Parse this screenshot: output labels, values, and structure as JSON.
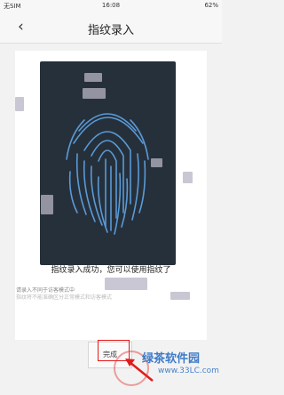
{
  "status": {
    "carrier": "无SIM",
    "time": "16:08",
    "battery": "62%"
  },
  "title": "指纹录入",
  "back_icon": "chevron-left-icon",
  "success_message": "指纹录入成功，您可以使用指纹了",
  "note": {
    "line1": "请录入不同于访客模式中",
    "line2": "指纹将不能准确区分正常模式和访客模式"
  },
  "button_label": "完成",
  "watermark": {
    "site": "绿茶软件园",
    "url": "www.33LC.com"
  },
  "colors": {
    "card": "#26303b",
    "fingerprint": "#5a9ad6",
    "highlight": "#e31b1b"
  }
}
